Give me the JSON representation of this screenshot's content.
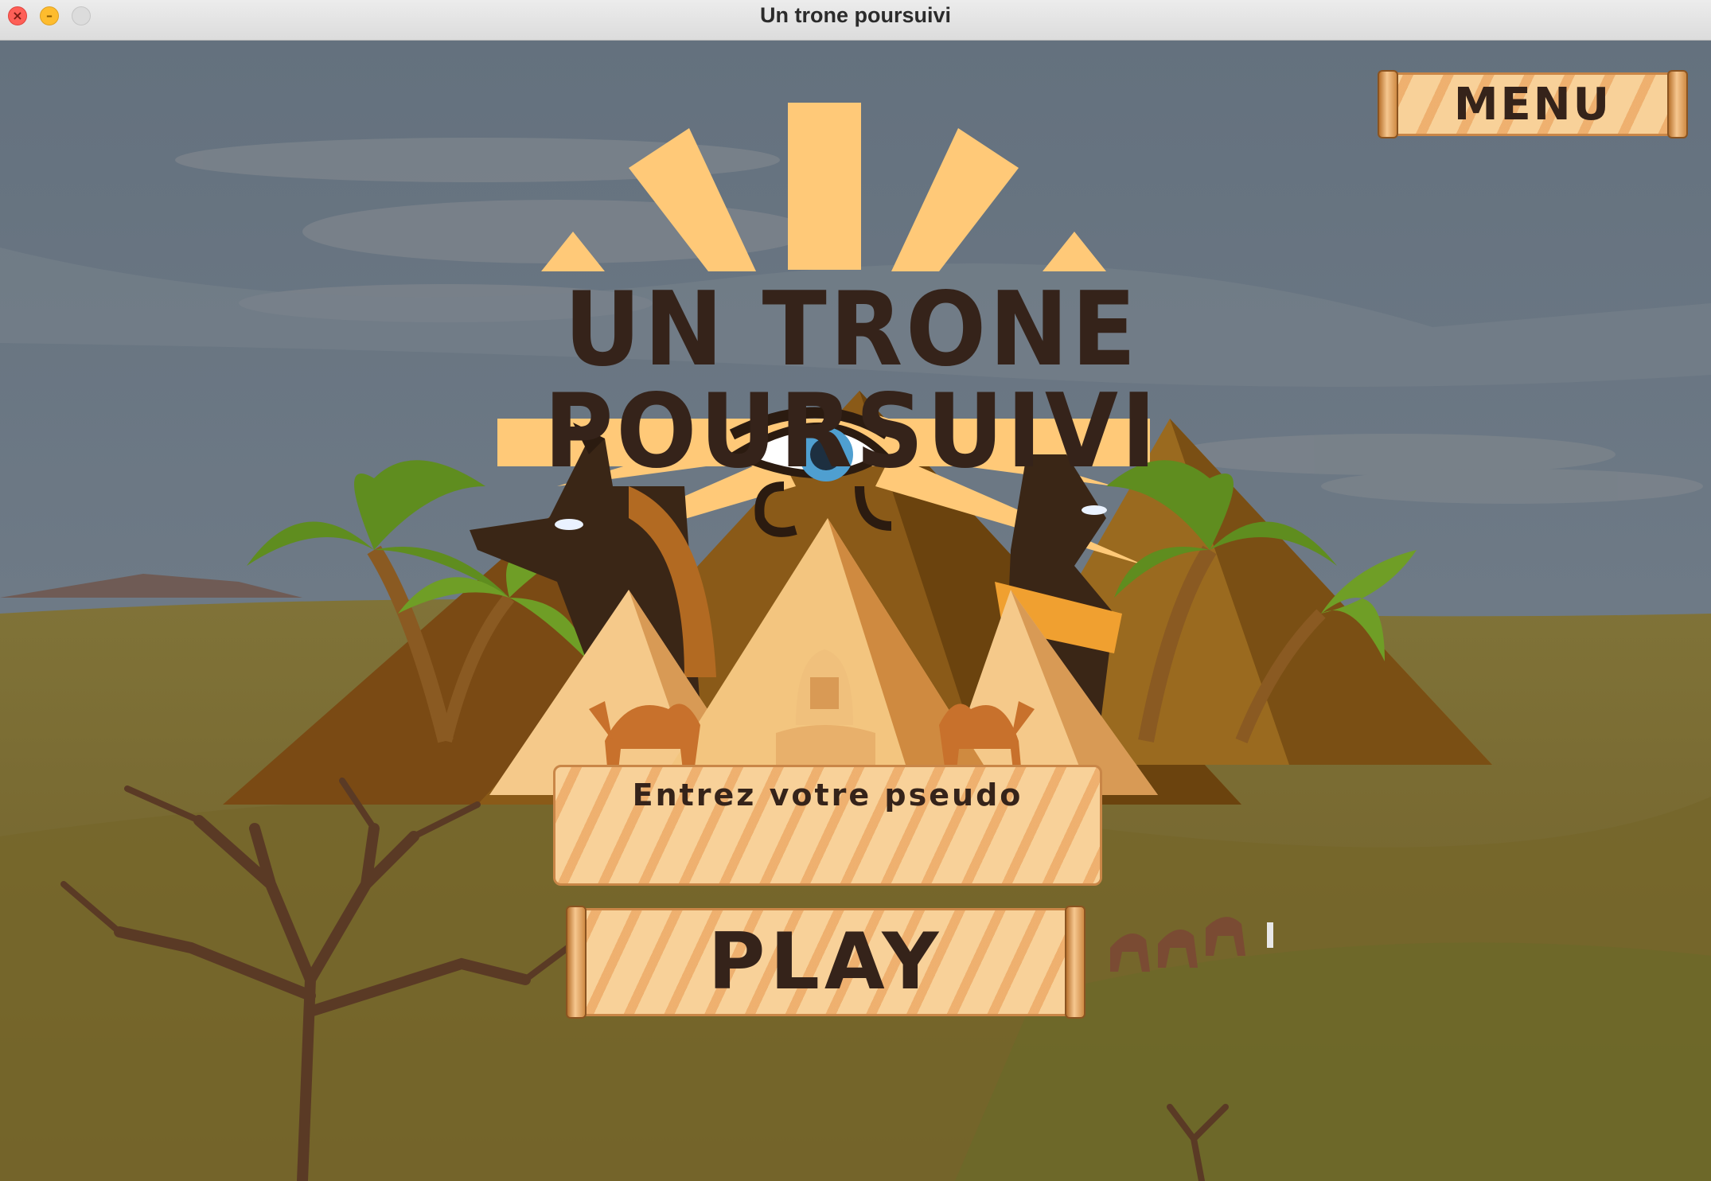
{
  "window": {
    "title": "Un trone poursuivi"
  },
  "game": {
    "title": "Un trone poursuivi",
    "menu_label": "MENU",
    "pseudo_placeholder": "Entrez votre pseudo",
    "pseudo_value": "",
    "play_label": "PLAY"
  },
  "colors": {
    "sky": "#6a7580",
    "sand": "#7d6a2f",
    "parchment": "#f8d199",
    "ink": "#35231a",
    "sun": "#ffc978"
  },
  "icons": [
    "close-icon",
    "minimize-icon",
    "eye-of-horus-icon",
    "anubis-icon",
    "bastet-cat-icon",
    "sphinx-icon",
    "camel-icon",
    "palm-tree-icon",
    "pyramid-icon"
  ]
}
